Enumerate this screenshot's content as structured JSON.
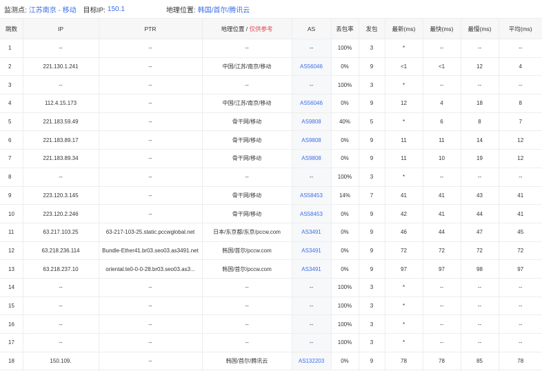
{
  "topbar": {
    "monitor_label": "监测点:",
    "monitor_value": "江苏南京 - 移动",
    "target_label": "目标IP:",
    "target_value": "150.1",
    "location_label": "地理位置:",
    "location_value": "韩国/首尔/腾讯云"
  },
  "table": {
    "headers": {
      "hop": "跳数",
      "ip": "IP",
      "ptr": "PTR",
      "geo": "地理位置 / ",
      "geo_note": "仅供参考",
      "as": "AS",
      "loss": "丢包率",
      "sent": "发包",
      "last": "最新(ms)",
      "best": "最快(ms)",
      "worst": "最慢(ms)",
      "avg": "平均(ms)"
    },
    "rows": [
      {
        "hop": "1",
        "ip": "--",
        "ptr": "--",
        "geo": "--",
        "as": "--",
        "loss": "100%",
        "sent": "3",
        "last": "*",
        "best": "--",
        "worst": "--",
        "avg": "--"
      },
      {
        "hop": "2",
        "ip": "221.130.1.241",
        "ptr": "--",
        "geo": "中国/江苏/南京/移动",
        "as": "AS56046",
        "loss": "0%",
        "sent": "9",
        "last": "<1",
        "best": "<1",
        "worst": "12",
        "avg": "4"
      },
      {
        "hop": "3",
        "ip": "--",
        "ptr": "--",
        "geo": "--",
        "as": "--",
        "loss": "100%",
        "sent": "3",
        "last": "*",
        "best": "--",
        "worst": "--",
        "avg": "--"
      },
      {
        "hop": "4",
        "ip": "112.4.15.173",
        "ptr": "--",
        "geo": "中国/江苏/南京/移动",
        "as": "AS56046",
        "loss": "0%",
        "sent": "9",
        "last": "12",
        "best": "4",
        "worst": "18",
        "avg": "8"
      },
      {
        "hop": "5",
        "ip": "221.183.59.49",
        "ptr": "--",
        "geo": "骨干网/移动",
        "as": "AS9808",
        "loss": "40%",
        "sent": "5",
        "last": "*",
        "best": "6",
        "worst": "8",
        "avg": "7"
      },
      {
        "hop": "6",
        "ip": "221.183.89.17",
        "ptr": "--",
        "geo": "骨干网/移动",
        "as": "AS9808",
        "loss": "0%",
        "sent": "9",
        "last": "11",
        "best": "11",
        "worst": "14",
        "avg": "12"
      },
      {
        "hop": "7",
        "ip": "221.183.89.34",
        "ptr": "--",
        "geo": "骨干网/移动",
        "as": "AS9808",
        "loss": "0%",
        "sent": "9",
        "last": "11",
        "best": "10",
        "worst": "19",
        "avg": "12"
      },
      {
        "hop": "8",
        "ip": "--",
        "ptr": "--",
        "geo": "--",
        "as": "--",
        "loss": "100%",
        "sent": "3",
        "last": "*",
        "best": "--",
        "worst": "--",
        "avg": "--"
      },
      {
        "hop": "9",
        "ip": "223.120.3.145",
        "ptr": "--",
        "geo": "骨干网/移动",
        "as": "AS58453",
        "loss": "14%",
        "sent": "7",
        "last": "41",
        "best": "41",
        "worst": "43",
        "avg": "41"
      },
      {
        "hop": "10",
        "ip": "223.120.2.246",
        "ptr": "--",
        "geo": "骨干网/移动",
        "as": "AS58453",
        "loss": "0%",
        "sent": "9",
        "last": "42",
        "best": "41",
        "worst": "44",
        "avg": "41"
      },
      {
        "hop": "11",
        "ip": "63.217.103.25",
        "ptr": "63-217-103-25.static.pccwglobal.net",
        "geo": "日本/东京都/东京/pccw.com",
        "as": "AS3491",
        "loss": "0%",
        "sent": "9",
        "last": "46",
        "best": "44",
        "worst": "47",
        "avg": "45"
      },
      {
        "hop": "12",
        "ip": "63.218.236.114",
        "ptr": "Bundle-Ether41.br03.seo03.as3491.net",
        "geo": "韩国/首尔/pccw.com",
        "as": "AS3491",
        "loss": "0%",
        "sent": "9",
        "last": "72",
        "best": "72",
        "worst": "72",
        "avg": "72"
      },
      {
        "hop": "13",
        "ip": "63.218.237.10",
        "ptr": "oriental.te0-0-0-28.br03.seo03.as3...",
        "geo": "韩国/首尔/pccw.com",
        "as": "AS3491",
        "loss": "0%",
        "sent": "9",
        "last": "97",
        "best": "97",
        "worst": "98",
        "avg": "97"
      },
      {
        "hop": "14",
        "ip": "--",
        "ptr": "--",
        "geo": "--",
        "as": "--",
        "loss": "100%",
        "sent": "3",
        "last": "*",
        "best": "--",
        "worst": "--",
        "avg": "--"
      },
      {
        "hop": "15",
        "ip": "--",
        "ptr": "--",
        "geo": "--",
        "as": "--",
        "loss": "100%",
        "sent": "3",
        "last": "*",
        "best": "--",
        "worst": "--",
        "avg": "--"
      },
      {
        "hop": "16",
        "ip": "--",
        "ptr": "--",
        "geo": "--",
        "as": "--",
        "loss": "100%",
        "sent": "3",
        "last": "*",
        "best": "--",
        "worst": "--",
        "avg": "--"
      },
      {
        "hop": "17",
        "ip": "--",
        "ptr": "--",
        "geo": "--",
        "as": "--",
        "loss": "100%",
        "sent": "3",
        "last": "*",
        "best": "--",
        "worst": "--",
        "avg": "--"
      },
      {
        "hop": "18",
        "ip": "150.109.",
        "ptr": "--",
        "geo": "韩国/首尔/腾讯云",
        "as": "AS132203",
        "loss": "0%",
        "sent": "9",
        "last": "78",
        "best": "78",
        "worst": "85",
        "avg": "78"
      }
    ]
  },
  "colors": {
    "link": "#3a6ee8",
    "warning": "#e24a4a",
    "header_bg": "#f7f7f8",
    "border": "#ededed"
  }
}
